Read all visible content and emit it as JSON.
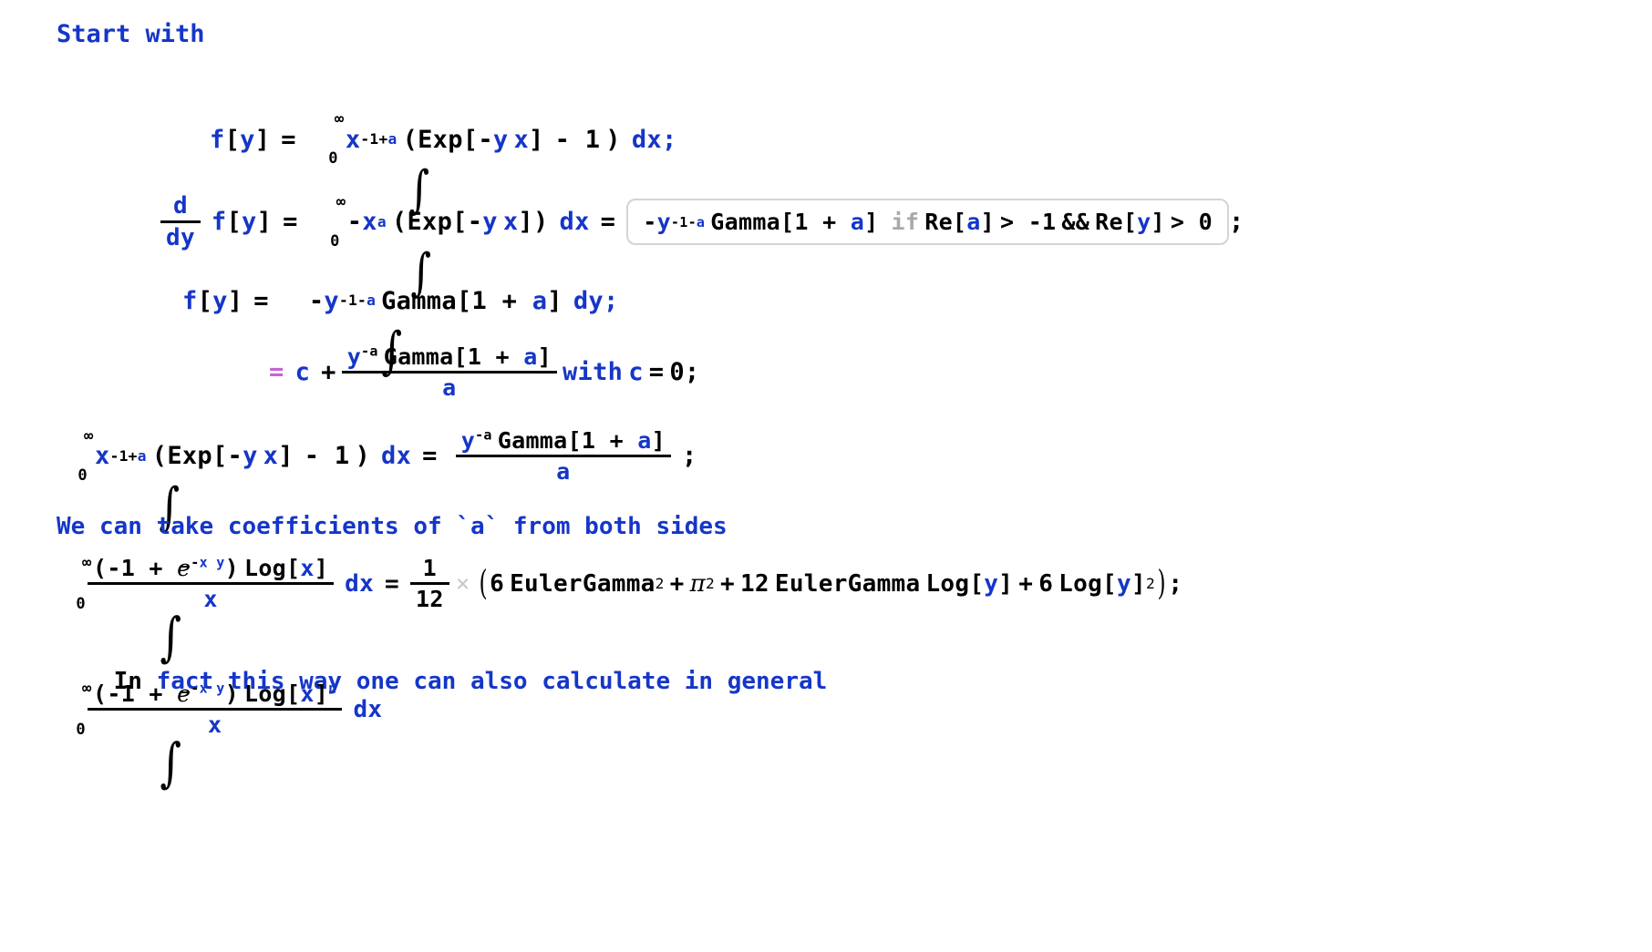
{
  "document": {
    "kind": "mathematica-notebook-derivation",
    "background": "#ffffff",
    "colors": {
      "blue": "#1536c8",
      "black": "#000000",
      "pink": "#c862d8",
      "grey": "#a9a9a9",
      "box_border": "#d4d4d4"
    }
  },
  "lines": {
    "heading": "Start with",
    "note_coefficients": "We can take coefficients of `a` from both sides",
    "note_general_prefix": "In",
    "note_general_rest": "fact this way one can also calculate in general"
  },
  "eq1": {
    "lhs_f": "f",
    "lhs_brk_open": "[",
    "lhs_var": "y",
    "lhs_brk_close": "]",
    "equals": "=",
    "int_upper": "∞",
    "int_lower": "0",
    "integrand_x": "x",
    "integrand_exp": "-1+a",
    "integrand_exp_num": "-1+",
    "integrand_exp_a": "a",
    "paren_open": "(",
    "exp_fn": "Exp",
    "exp_brk_open": "[",
    "exp_minus": "-",
    "exp_y": "y",
    "exp_x": "x",
    "exp_brk_close": "]",
    "minus_one": "- 1",
    "paren_close": ")",
    "dx": "dx",
    "semicolon": ";"
  },
  "eq2": {
    "frac_num": "d",
    "frac_den": "dy",
    "f": "f",
    "brk_open": "[",
    "var": "y",
    "brk_close": "]",
    "equals1": "=",
    "int_upper": "∞",
    "int_lower": "0",
    "neg": "-",
    "x": "x",
    "x_exp": "a",
    "paren_open": "(",
    "exp_fn": "Exp",
    "exp_brk_open": "[",
    "exp_minus": "-",
    "exp_y": "y",
    "exp_x": "x",
    "exp_brk_close": "]",
    "paren_close": ")",
    "dx": "dx",
    "equals2": "=",
    "boxed": {
      "neg": "-",
      "y": "y",
      "y_exp_sign": "-1-",
      "y_exp_a": "a",
      "gamma": "Gamma",
      "gamma_brk_open": "[",
      "gamma_one_plus": "1 + ",
      "gamma_a": "a",
      "gamma_brk_close": "]",
      "if_kw": "if",
      "cond_re1": "Re",
      "cond_brk_open1": "[",
      "cond_a": "a",
      "cond_brk_close1": "]",
      "cond_gt1": "> -1",
      "cond_and": "&&",
      "cond_re2": "Re",
      "cond_brk_open2": "[",
      "cond_y": "y",
      "cond_brk_close2": "]",
      "cond_gt2": "> 0"
    },
    "semicolon": ";"
  },
  "eq3": {
    "f": "f",
    "brk_open": "[",
    "var": "y",
    "brk_close": "]",
    "equals": "=",
    "integral": "∫",
    "neg": "-",
    "y": "y",
    "y_exp": "-1-",
    "y_exp_a": "a",
    "gamma": "Gamma",
    "gamma_brk_open": "[",
    "gamma_one_plus": "1 + ",
    "gamma_a": "a",
    "gamma_brk_close": "]",
    "dy": "dy",
    "semicolon": ";"
  },
  "eq4": {
    "equals": "=",
    "c": "c",
    "plus": "+",
    "num_y": "y",
    "num_y_exp": "-a",
    "num_gamma": "Gamma",
    "num_brk_open": "[",
    "num_one_plus": "1 + ",
    "num_a": "a",
    "num_brk_close": "]",
    "den_a": "a",
    "with": "with",
    "c2": "c",
    "equals2": "=",
    "zero": "0",
    "semicolon": ";"
  },
  "eq5": {
    "int_upper": "∞",
    "int_lower": "0",
    "x": "x",
    "x_exp_num": "-1+",
    "x_exp_a": "a",
    "paren_open": "(",
    "exp_fn": "Exp",
    "exp_brk_open": "[",
    "exp_minus": "-",
    "exp_y": "y",
    "exp_x": "x",
    "exp_brk_close": "]",
    "minus_one": "- 1",
    "paren_close": ")",
    "dx": "dx",
    "equals": "=",
    "num_y": "y",
    "num_y_exp": "-a",
    "num_gamma": "Gamma",
    "num_brk_open": "[",
    "num_one_plus": "1 + ",
    "num_a": "a",
    "num_brk_close": "]",
    "den_a": "a",
    "semicolon": ";"
  },
  "eq6": {
    "int_upper": "∞",
    "int_lower": "0",
    "num_paren_open": "(",
    "num_neg_one": "-1 + ",
    "num_e": "ℯ",
    "num_e_exp_minus": "-",
    "num_e_exp_x": "x",
    "num_e_exp_y": "y",
    "num_paren_close": ")",
    "num_log": "Log",
    "num_log_brk_open": "[",
    "num_log_x": "x",
    "num_log_brk_close": "]",
    "den_x": "x",
    "dx": "dx",
    "equals": "=",
    "frac_num": "1",
    "frac_den": "12",
    "times": "×",
    "paren_open": "(",
    "t1_coef": "6",
    "t1_name": "EulerGamma",
    "t1_exp": "2",
    "plus1": "+",
    "t2_pi": "π",
    "t2_exp": "2",
    "plus2": "+",
    "t3_coef": "12",
    "t3_name": "EulerGamma",
    "t3_log": "Log",
    "t3_brk_open": "[",
    "t3_y": "y",
    "t3_brk_close": "]",
    "plus3": "+",
    "t4_coef": "6",
    "t4_log": "Log",
    "t4_brk_open": "[",
    "t4_y": "y",
    "t4_brk_close": "]",
    "t4_exp": "2",
    "paren_close": ")",
    "semicolon": ";"
  },
  "eq7": {
    "int_upper": "∞",
    "int_lower": "0",
    "num_paren_open": "(",
    "num_neg_one": "-1 + ",
    "num_e": "ℯ",
    "num_e_exp_minus": "-",
    "num_e_exp_x": "x",
    "num_e_exp_y": "y",
    "num_paren_close": ")",
    "num_log": "Log",
    "num_log_brk_open": "[",
    "num_log_x": "x",
    "num_log_brk_close": "]",
    "num_log_exp_n": "n",
    "den_x": "x",
    "dx": "dx"
  }
}
